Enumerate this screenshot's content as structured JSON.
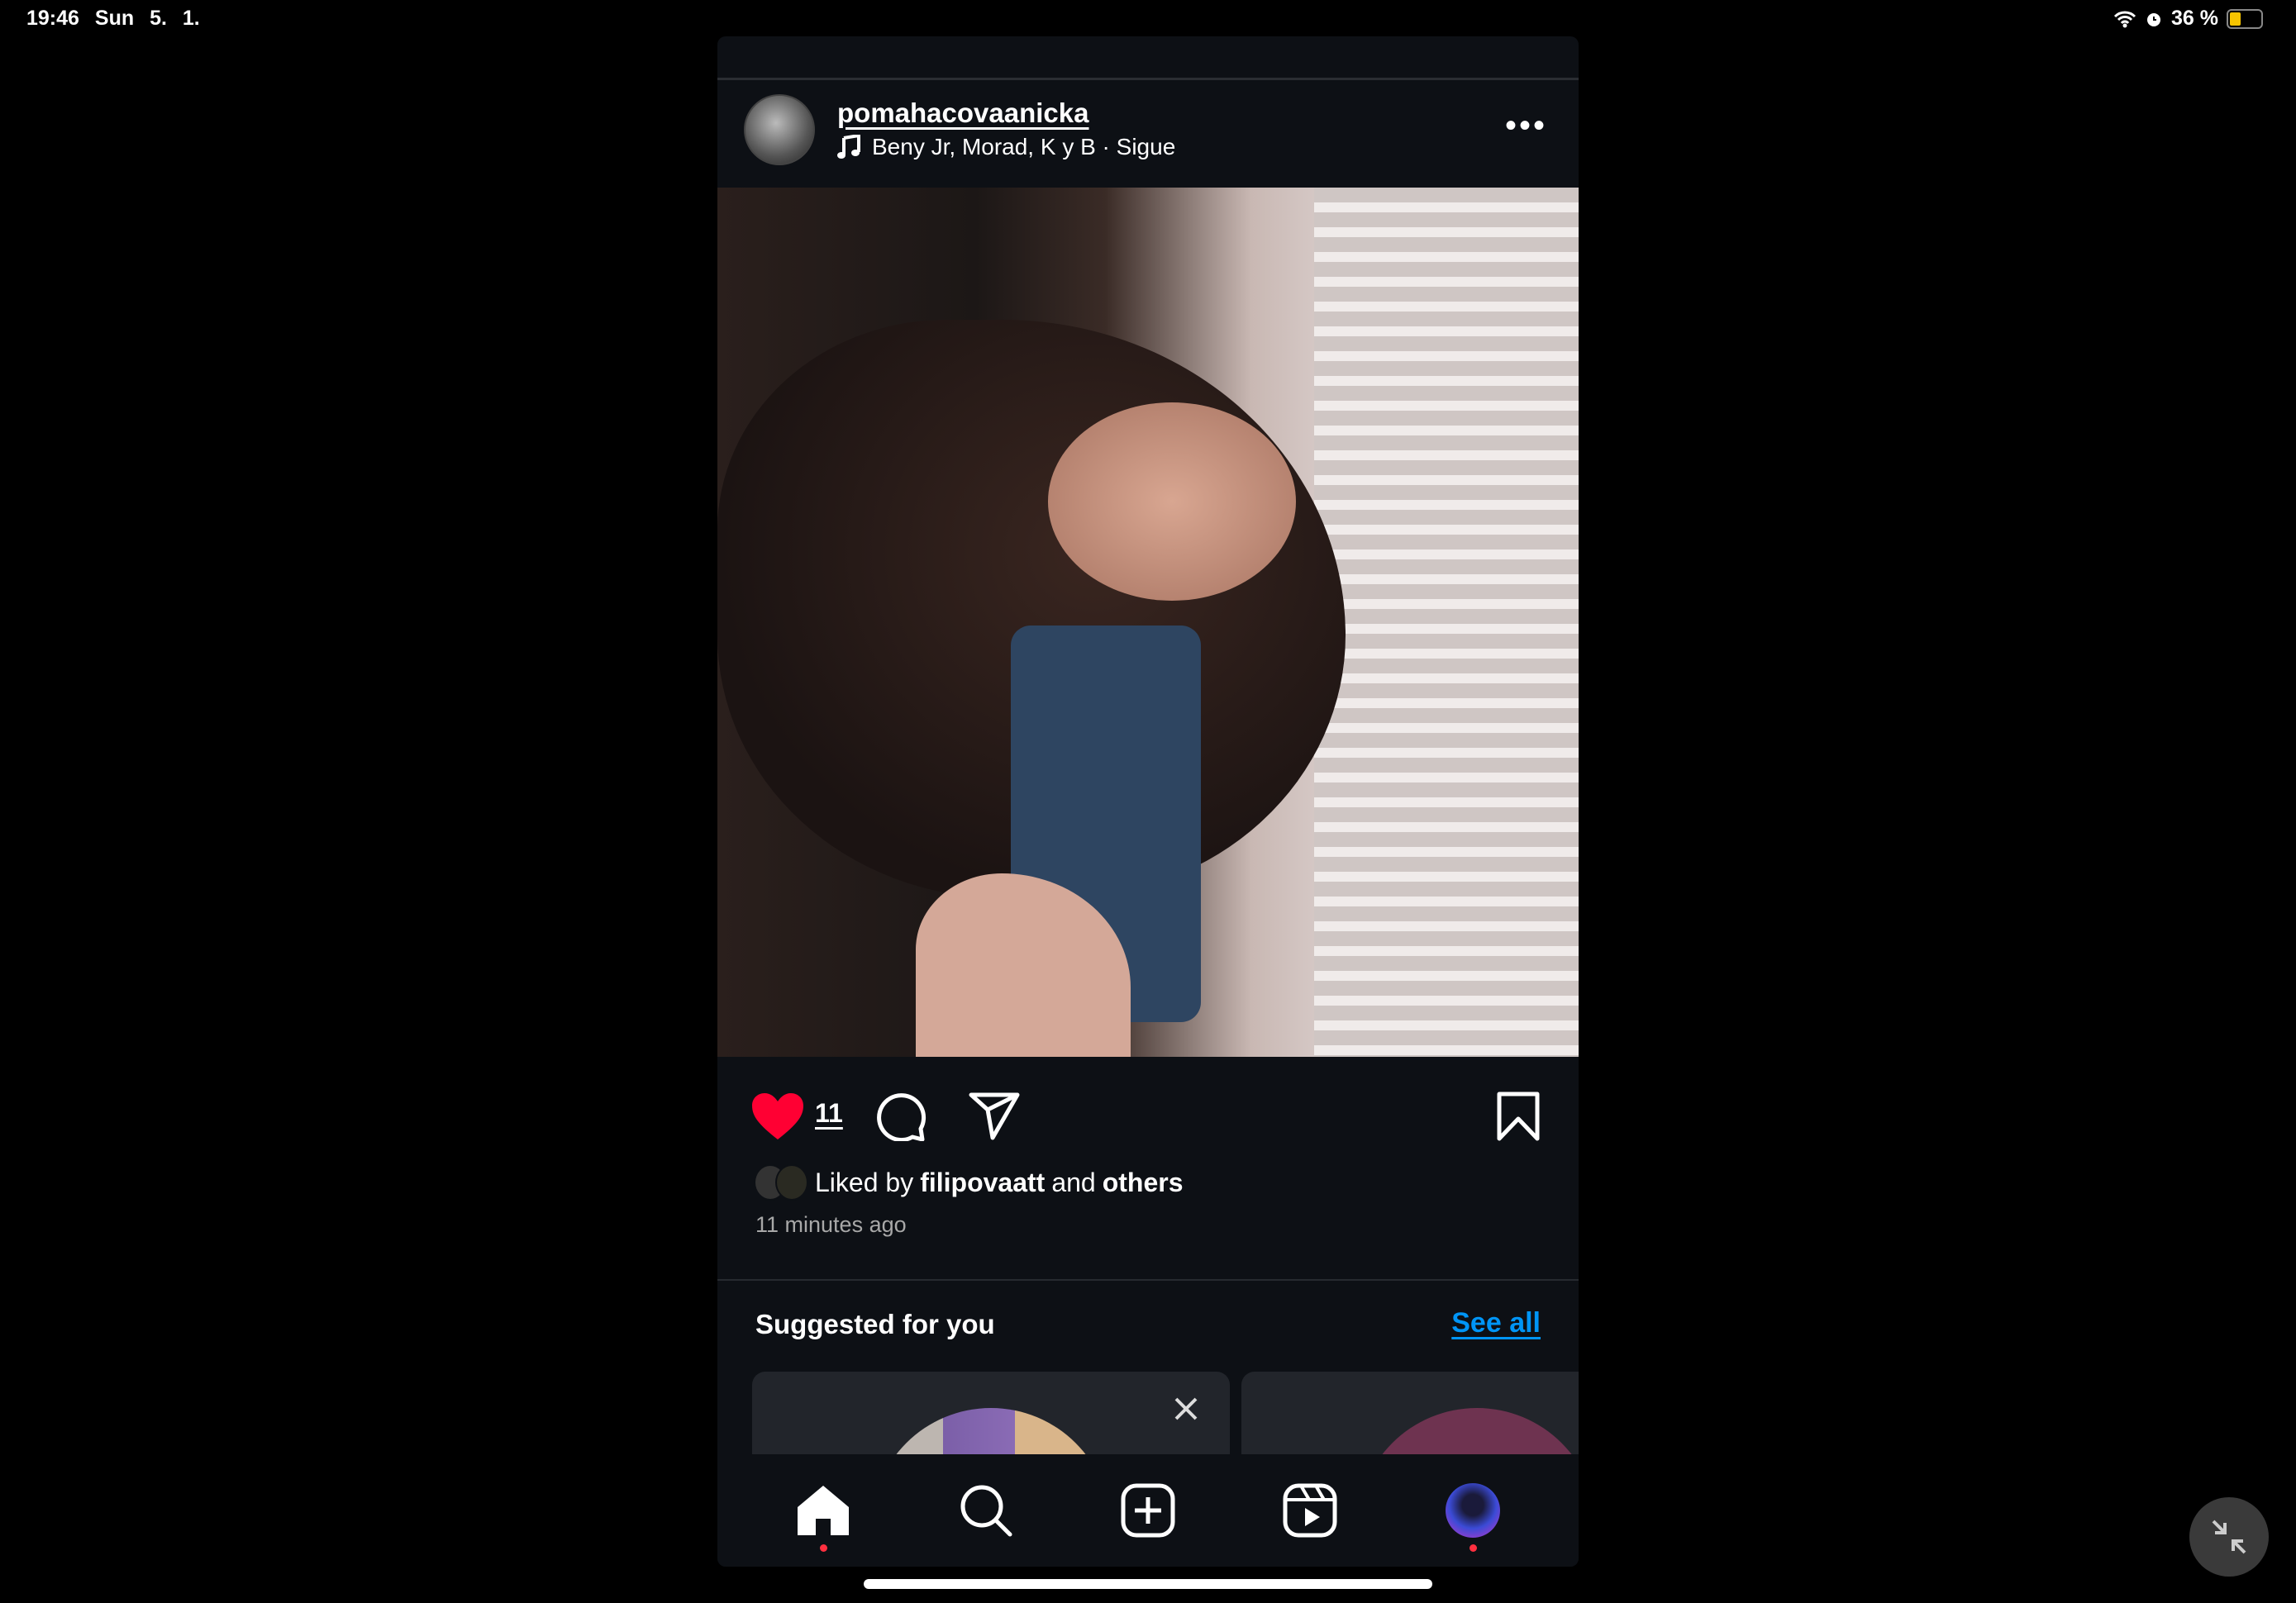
{
  "status_bar": {
    "time": "19:46",
    "date": "Sun 5. 1.",
    "battery": "36 %",
    "battery_level": 0.36,
    "battery_color": "#f7c500"
  },
  "post": {
    "username": "pomahacovaanicka",
    "audio": "Beny Jr, Morad, K y B · Sigue",
    "likes": "11",
    "liked_prefix": "Liked by",
    "liked_user": "filipovaatt",
    "liked_and": "and",
    "liked_others": "others",
    "time_ago": "11 minutes ago",
    "like_color": "#ff0033"
  },
  "suggested": {
    "title": "Suggested for you",
    "see_all": "See all",
    "link_color": "#0095f6"
  },
  "nav": {
    "items": [
      "home-icon",
      "search-icon",
      "create-icon",
      "reels-icon",
      "profile-avatar"
    ]
  }
}
